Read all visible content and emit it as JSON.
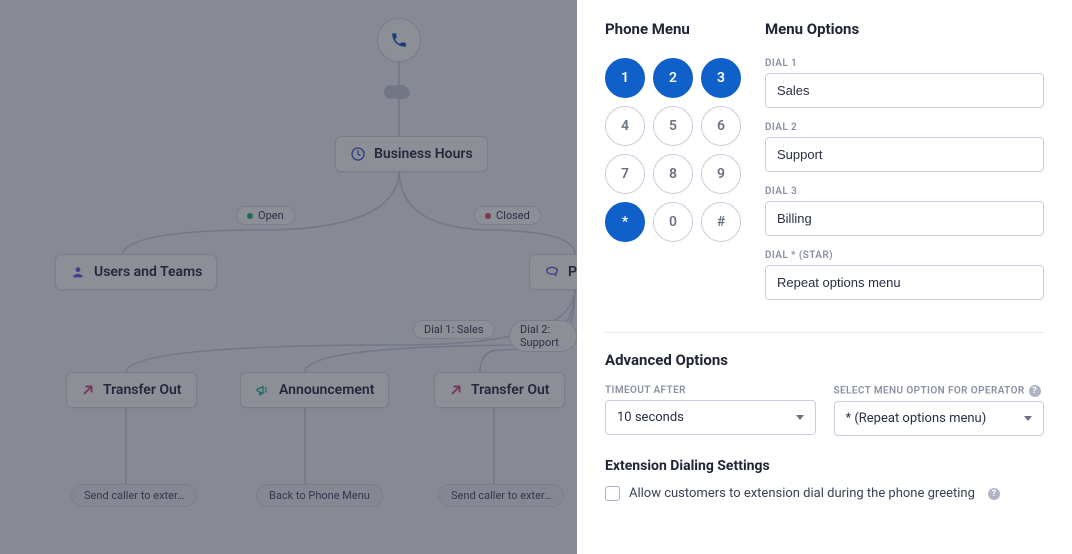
{
  "canvas": {
    "nodes": {
      "business_hours": "Business Hours",
      "users_teams": "Users and Teams",
      "phone_menu_partial": "P",
      "announcement": "Announcement",
      "transfer_out_left": "Transfer Out",
      "transfer_out_right": "Transfer Out"
    },
    "badges": {
      "open": "Open",
      "closed": "Closed",
      "dial1": "Dial 1: Sales",
      "dial2": "Dial 2: Support"
    },
    "pills": {
      "send_left": "Send caller to exter…",
      "back": "Back to Phone Menu",
      "send_right": "Send caller to exter…"
    }
  },
  "panel": {
    "phone_menu_title": "Phone Menu",
    "menu_options_title": "Menu Options",
    "keys": [
      "1",
      "2",
      "3",
      "4",
      "5",
      "6",
      "7",
      "8",
      "9",
      "*",
      "0",
      "#"
    ],
    "active_keys": [
      "1",
      "2",
      "3",
      "*"
    ],
    "dials": [
      {
        "label": "DIAL 1",
        "value": "Sales"
      },
      {
        "label": "DIAL 2",
        "value": "Support"
      },
      {
        "label": "DIAL 3",
        "value": "Billing"
      },
      {
        "label": "DIAL * (STAR)",
        "value": "Repeat options menu"
      }
    ],
    "advanced_title": "Advanced Options",
    "timeout_label": "TIMEOUT AFTER",
    "timeout_value": "10 seconds",
    "operator_label": "SELECT MENU OPTION FOR OPERATOR",
    "operator_value": "* (Repeat options menu)",
    "extension_title": "Extension Dialing Settings",
    "extension_checkbox": "Allow customers to extension dial during the phone greeting"
  },
  "colors": {
    "accent": "#1060c9",
    "icon_blue": "#3b5fd4",
    "icon_pink": "#d93f87",
    "icon_teal": "#2ab7a9",
    "icon_purple": "#6a5fe0"
  }
}
